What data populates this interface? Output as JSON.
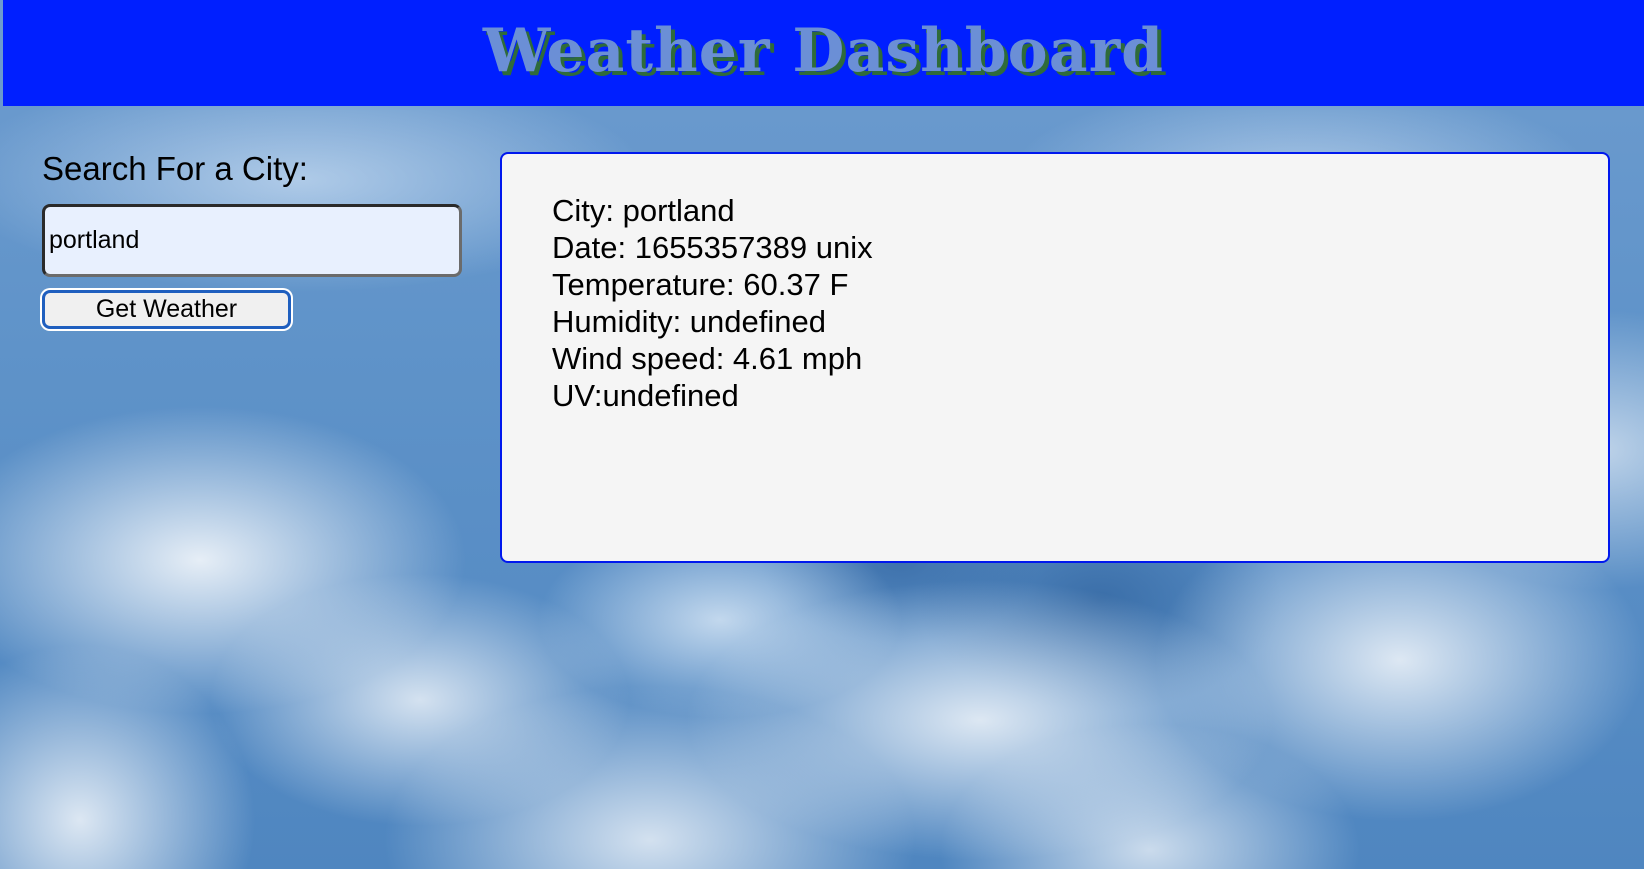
{
  "header": {
    "title": "Weather Dashboard"
  },
  "search": {
    "label": "Search For a City:",
    "value": "portland",
    "button_label": "Get Weather"
  },
  "results": {
    "city": "City: portland",
    "date": "Date: 1655357389 unix",
    "temperature": "Temperature: 60.37 F",
    "humidity": "Humidity: undefined",
    "wind_speed": "Wind speed: 4.61 mph",
    "uv": "UV:undefined"
  },
  "colors": {
    "header_background": "#001fff",
    "header_title": "#6b8fd6",
    "card_border": "#0018ee",
    "card_background": "#f5f5f5",
    "input_background": "#e8f0fe"
  }
}
